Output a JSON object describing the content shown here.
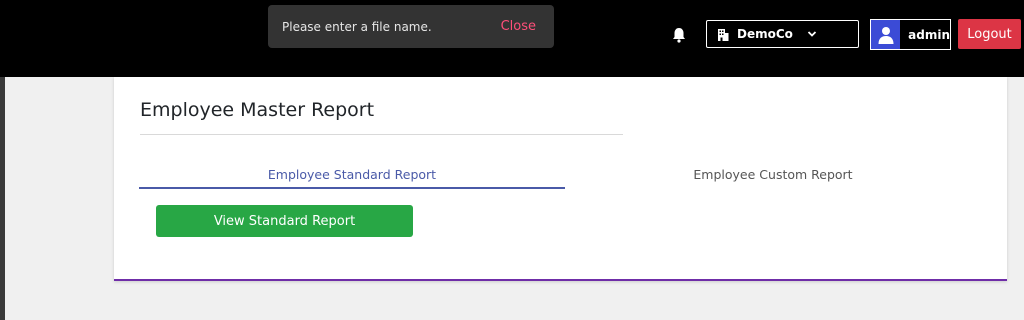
{
  "toast": {
    "message": "Please enter a file name.",
    "close_label": "Close"
  },
  "header": {
    "company": "DemoCo",
    "user": "admin",
    "logout_label": "Logout",
    "icons": [
      "bell-icon",
      "building-icon",
      "chevron-down-icon",
      "user-icon"
    ]
  },
  "card": {
    "title": "Employee Master Report",
    "tabs": [
      {
        "label": "Employee Standard Report",
        "active": true
      },
      {
        "label": "Employee Custom Report",
        "active": false
      }
    ],
    "view_button_label": "View Standard Report"
  },
  "colors": {
    "topbar": "#000000",
    "logout": "#dc3545",
    "active_tab": "#4a5aa8",
    "view_button": "#28a745",
    "card_accent": "#6f2da8",
    "toast_close": "#ff4f7a"
  }
}
